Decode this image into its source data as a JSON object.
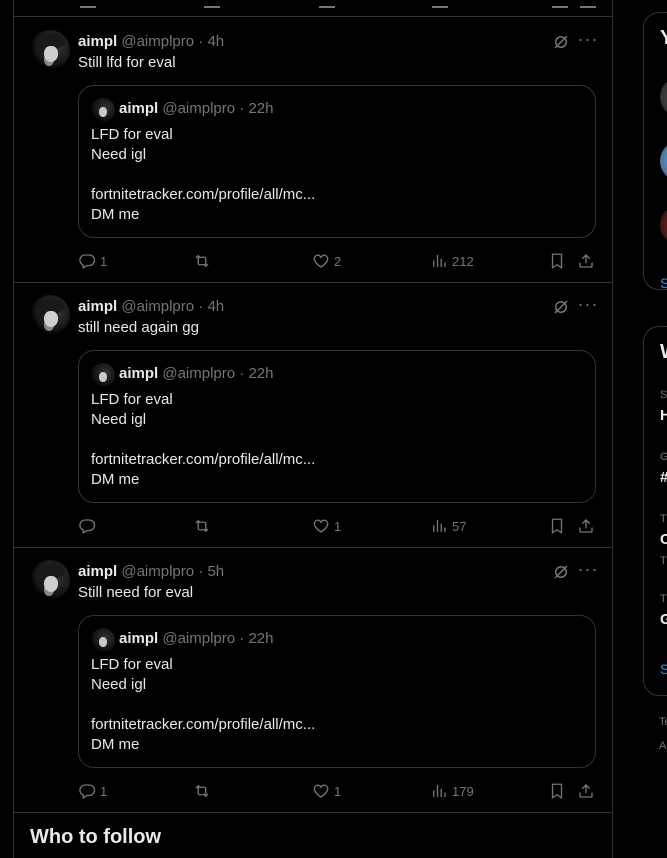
{
  "tweets": [
    {
      "name": "aimpl",
      "handle": "@aimplpro",
      "time": "4h",
      "text": "Still lfd for eval",
      "quote": {
        "name": "aimpl",
        "handle": "@aimplpro",
        "time": "22h",
        "lines": [
          "LFD for eval",
          "Need igl",
          "",
          "fortnitetracker.com/profile/all/mc...",
          "DM me"
        ]
      },
      "replies": "1",
      "retweets": "",
      "likes": "2",
      "views": "212"
    },
    {
      "name": "aimpl",
      "handle": "@aimplpro",
      "time": "4h",
      "text": "still need again gg",
      "quote": {
        "name": "aimpl",
        "handle": "@aimplpro",
        "time": "22h",
        "lines": [
          "LFD for eval",
          "Need igl",
          "",
          "fortnitetracker.com/profile/all/mc...",
          "DM me"
        ]
      },
      "replies": "",
      "retweets": "",
      "likes": "1",
      "views": "57"
    },
    {
      "name": "aimpl",
      "handle": "@aimplpro",
      "time": "5h",
      "text": "Still need for eval",
      "quote": {
        "name": "aimpl",
        "handle": "@aimplpro",
        "time": "22h",
        "lines": [
          "LFD for eval",
          "Need igl",
          "",
          "fortnitetracker.com/profile/all/mc...",
          "DM me"
        ]
      },
      "replies": "1",
      "retweets": "",
      "likes": "1",
      "views": "179"
    }
  ],
  "separator": "·",
  "who_to_follow": {
    "title": "Who to follow"
  },
  "right_sidebar": {
    "card1": {
      "title_initial": "Y",
      "link": "S"
    },
    "card2": {
      "title_initial": "W",
      "rows": [
        {
          "small": "S",
          "bold": "H"
        },
        {
          "small": "G",
          "bold": "#"
        },
        {
          "small": "T",
          "bold": "C",
          "small2": "T"
        },
        {
          "small": "T",
          "bold": "G"
        }
      ],
      "link": "S"
    },
    "footer": [
      "Te",
      "A"
    ]
  },
  "colors": {
    "accent": "#1d9bf0",
    "muted": "#71767b",
    "border": "#2f3336",
    "text": "#e7e9ea",
    "background": "#000000"
  }
}
